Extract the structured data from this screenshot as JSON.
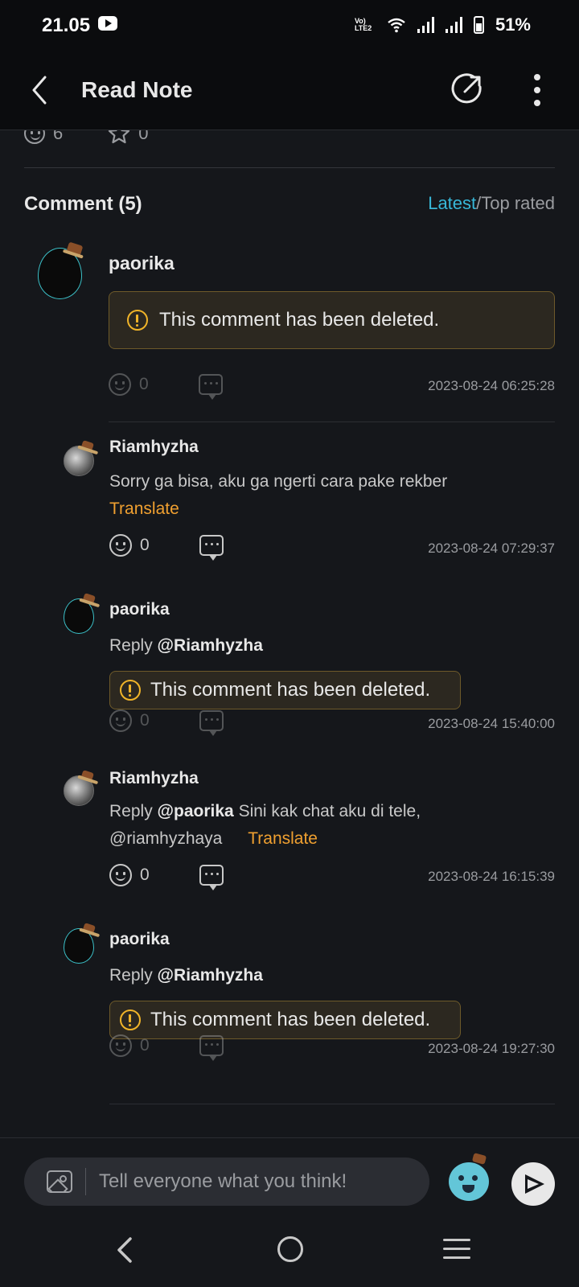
{
  "status_bar": {
    "time": "21.05",
    "volte": "Vo) LTE2",
    "battery": "51%"
  },
  "app_bar": {
    "title": "Read Note"
  },
  "note_stats": {
    "likes": "6",
    "favorites": "0"
  },
  "comments_section": {
    "title": "Comment (5)",
    "sort_latest": "Latest",
    "sort_separator": "/",
    "sort_top": "Top rated",
    "deleted_message": "This comment has been deleted.",
    "translate_label": "Translate",
    "reply_prefix": "Reply",
    "items": [
      {
        "user": "paorika",
        "deleted": true,
        "likes": "0",
        "timestamp": "2023-08-24 06:25:28"
      },
      {
        "user": "Riamhyzha",
        "text": "Sorry ga bisa, aku ga ngerti cara pake rekber",
        "likes": "0",
        "timestamp": "2023-08-24 07:29:37"
      },
      {
        "user": "paorika",
        "reply_to": "@Riamhyzha",
        "deleted": true,
        "likes": "0",
        "timestamp": "2023-08-24 15:40:00"
      },
      {
        "user": "Riamhyzha",
        "reply_to": "@paorika",
        "text": "Sini kak chat aku di tele,",
        "text_line2": "@riamhyzhaya",
        "likes": "0",
        "timestamp": "2023-08-24 16:15:39"
      },
      {
        "user": "paorika",
        "reply_to": "@Riamhyzha",
        "deleted": true,
        "likes": "0",
        "timestamp": "2023-08-24 19:27:30"
      }
    ]
  },
  "composer": {
    "placeholder": "Tell everyone what you think!"
  },
  "colors": {
    "accent": "#38b7d8",
    "translate": "#f0a030",
    "warning": "#f0b429",
    "background": "#15171b"
  }
}
